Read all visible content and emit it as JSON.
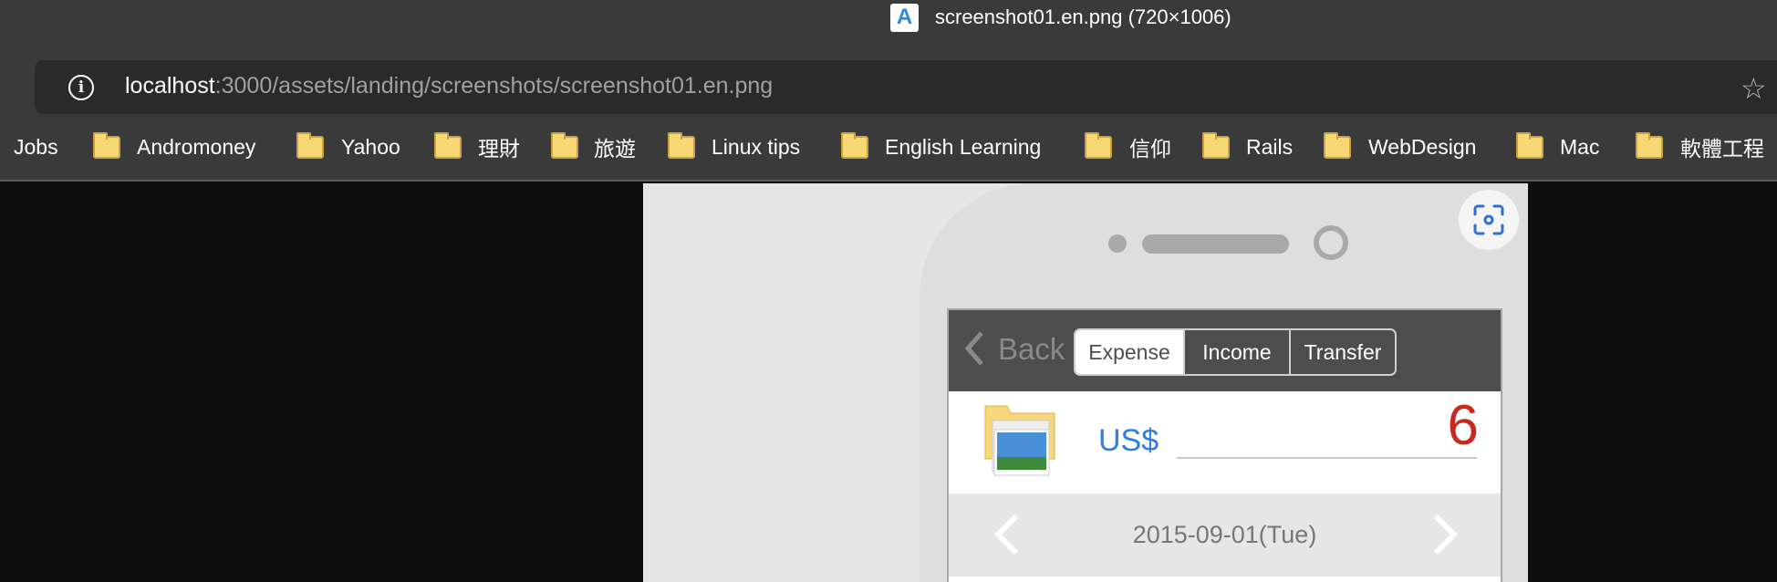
{
  "tab": {
    "title": "screenshot01.en.png (720×1006)",
    "favicon": "image-viewer-icon"
  },
  "address_bar": {
    "host": "localhost",
    "path": ":3000/assets/landing/screenshots/screenshot01.en.png"
  },
  "bookmarks": [
    "Jobs",
    "Andromoney",
    "Yahoo",
    "理財",
    "旅遊",
    "Linux tips",
    "English Learning",
    "信仰",
    "Rails",
    "WebDesign",
    "Mac",
    "軟體工程"
  ],
  "app": {
    "back_label": "Back",
    "tabs": [
      "Expense",
      "Income",
      "Transfer"
    ],
    "selected_tab": "Expense",
    "currency": "US$",
    "amount": "6",
    "date": "2015-09-01(Tue)",
    "colors": {
      "header": "#4d4d4d",
      "currency": "#2f7de1",
      "amount": "#c8281e"
    }
  }
}
